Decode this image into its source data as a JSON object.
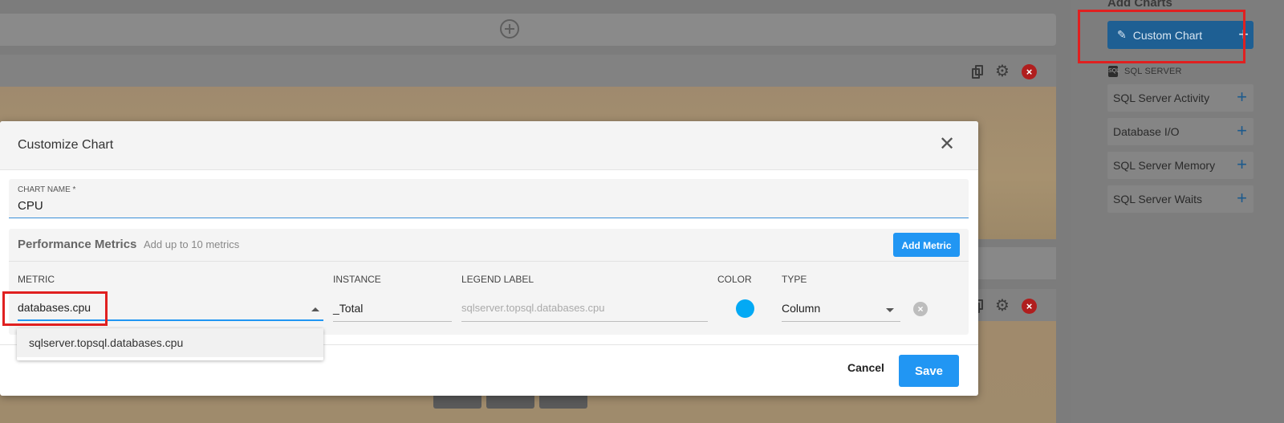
{
  "side_panel": {
    "title": "Add Charts",
    "custom_chart_label": "Custom Chart",
    "section_label": "SQL SERVER",
    "items": [
      {
        "label": "SQL Server Activity"
      },
      {
        "label": "Database I/O"
      },
      {
        "label": "SQL Server Memory"
      },
      {
        "label": "SQL Server Waits"
      }
    ]
  },
  "modal": {
    "title": "Customize Chart",
    "chart_name_label": "CHART NAME *",
    "chart_name_value": "CPU",
    "metrics_title": "Performance Metrics",
    "metrics_subtitle": "Add up to 10 metrics",
    "add_metric_label": "Add Metric",
    "columns": {
      "metric": "METRIC",
      "instance": "INSTANCE",
      "legend_label": "LEGEND LABEL",
      "color": "COLOR",
      "type": "TYPE"
    },
    "row": {
      "metric": "databases.cpu",
      "instance": "_Total",
      "legend_placeholder": "sqlserver.topsql.databases.cpu",
      "color": "#03a9f4",
      "type": "Column"
    },
    "suggestion": "sqlserver.topsql.databases.cpu",
    "cancel_label": "Cancel",
    "save_label": "Save"
  },
  "colors": {
    "accent": "#2196f3",
    "highlight": "#e02020"
  }
}
